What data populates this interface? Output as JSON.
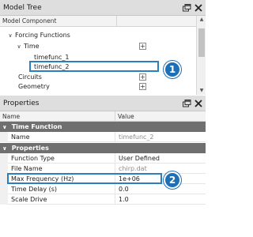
{
  "model_tree": {
    "title": "Model Tree",
    "column_header": "Model Component",
    "items": [
      {
        "label": "Forcing Functions",
        "expanded": true
      },
      {
        "label": "Time",
        "expanded": true
      },
      {
        "label": "timefunc_1"
      },
      {
        "label": "timefunc_2",
        "selected": true
      },
      {
        "label": "Circuits"
      },
      {
        "label": "Geometry"
      }
    ],
    "icons": {
      "dock": "float-window-icon",
      "close": "close-icon",
      "expand": "plus-icon",
      "expanded": "chevron-down-icon"
    }
  },
  "properties": {
    "title": "Properties",
    "columns": {
      "name": "Name",
      "value": "Value"
    },
    "sections": [
      {
        "label": "Time Function",
        "rows": [
          {
            "name": "Name",
            "value": "timefunc_2",
            "readonly": true
          }
        ]
      },
      {
        "label": "Properties",
        "rows": [
          {
            "name": "Function Type",
            "value": "User Defined",
            "readonly": false
          },
          {
            "name": "File Name",
            "value": "chirp.dat",
            "readonly": true
          },
          {
            "name": "Max Frequency (Hz)",
            "value": "1e+06",
            "readonly": false
          },
          {
            "name": "Time Delay (s)",
            "value": "0.0",
            "readonly": false
          },
          {
            "name": "Scale Drive",
            "value": "1.0",
            "readonly": false
          }
        ]
      }
    ]
  },
  "callouts": [
    "1",
    "2"
  ],
  "colors": {
    "highlight": "#2a7fc0",
    "callout": "#1f6fb6",
    "section_bar": "#6f6f6f"
  }
}
